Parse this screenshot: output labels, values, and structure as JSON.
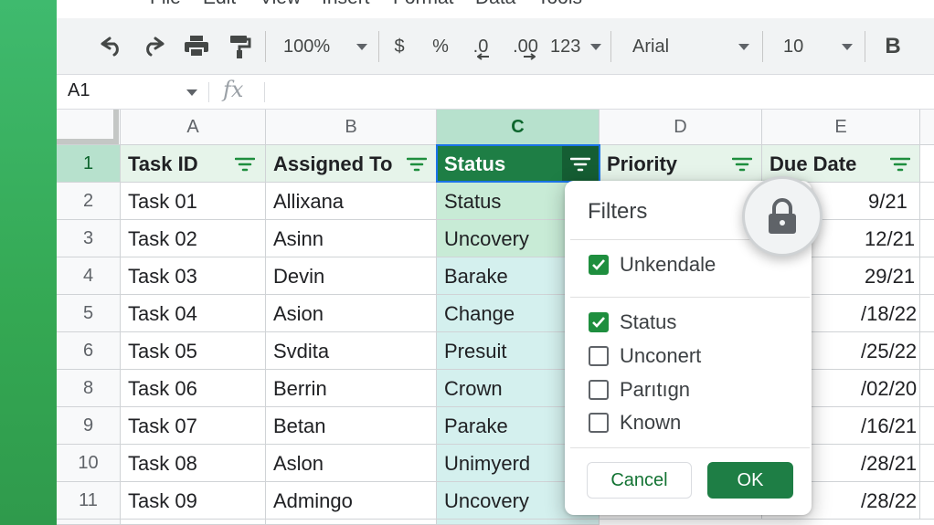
{
  "menubar": {
    "items": [
      "File",
      "Edit",
      "View",
      "Insert",
      "Format",
      "Data",
      "Tools"
    ]
  },
  "toolbar": {
    "zoom": "100%",
    "currency": "$",
    "percent": "%",
    "decrease_decimal": ".0",
    "increase_decimal": ".00",
    "number_format": "123",
    "font_name": "Arial",
    "font_size": "10",
    "bold": "B"
  },
  "formula_bar": {
    "name_box": "A1",
    "fx": "fx",
    "value": ""
  },
  "grid": {
    "columns": [
      "A",
      "B",
      "C",
      "D",
      "E"
    ],
    "header_row_number": "1",
    "headers": [
      "Task ID",
      "Assigned To",
      "Status",
      "Priority",
      "Due Date"
    ],
    "rows": [
      {
        "num": "2",
        "task": "Task 01",
        "assigned": "Allixana",
        "status": "Status",
        "priority": "",
        "due": "9/21"
      },
      {
        "num": "3",
        "task": "Task 02",
        "assigned": "Asinn",
        "status": "Uncovery",
        "priority": "",
        "due": "12/21"
      },
      {
        "num": "4",
        "task": "Task 03",
        "assigned": "Devin",
        "status": "Barake",
        "priority": "",
        "due": "29/21"
      },
      {
        "num": "5",
        "task": "Task 04",
        "assigned": "Asion",
        "status": "Change",
        "priority": "",
        "due": "/18/22"
      },
      {
        "num": "6",
        "task": "Task 05",
        "assigned": "Svdita",
        "status": "Presuit",
        "priority": "",
        "due": "/25/22"
      },
      {
        "num": "8",
        "task": "Task 06",
        "assigned": "Berrin",
        "status": "Crown",
        "priority": "",
        "due": "/02/20"
      },
      {
        "num": "9",
        "task": "Task 07",
        "assigned": "Betan",
        "status": "Parake",
        "priority": "",
        "due": "/16/21"
      },
      {
        "num": "10",
        "task": "Task 08",
        "assigned": "Aslon",
        "status": "Unimyerd",
        "priority": "",
        "due": "/28/21"
      },
      {
        "num": "11",
        "task": "Task 09",
        "assigned": "Admingo",
        "status": "Uncovery",
        "priority": "",
        "due": "/28/22"
      }
    ]
  },
  "filter_menu": {
    "title": "Filters",
    "options": [
      {
        "label": "Unkendale",
        "checked": true
      },
      {
        "label": "Status",
        "checked": true
      },
      {
        "label": "Unconert",
        "checked": false
      },
      {
        "label": "Parıtıgn",
        "checked": false
      },
      {
        "label": "Known",
        "checked": false
      }
    ],
    "cancel_label": "Cancel",
    "ok_label": "OK"
  },
  "colors": {
    "accent_green": "#1e7e45",
    "side_strip": "#34a853",
    "selected_header": "#b7e1cd",
    "status_column": "#d4f0ee",
    "selection_outline": "#1a73e8"
  },
  "icons": [
    "undo-icon",
    "redo-icon",
    "print-icon",
    "paint-format-icon",
    "filter-icon",
    "lock-icon",
    "checkbox-checked-icon"
  ]
}
